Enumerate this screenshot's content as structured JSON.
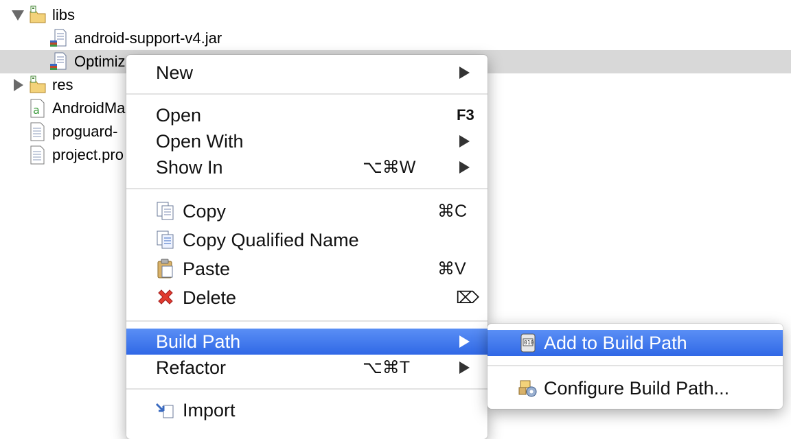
{
  "tree": {
    "items": [
      {
        "label": "libs",
        "icon": "folder-library-icon",
        "expanded": true
      },
      {
        "label": "android-support-v4.jar",
        "icon": "jar-file-icon"
      },
      {
        "label": "Optimiz",
        "icon": "jar-file-icon",
        "selected": true
      },
      {
        "label": "res",
        "icon": "folder-resources-icon",
        "expanded": false
      },
      {
        "label": "AndroidMa",
        "icon": "android-manifest-icon"
      },
      {
        "label": "proguard-",
        "icon": "text-file-icon"
      },
      {
        "label": "project.pro",
        "icon": "text-file-icon"
      }
    ]
  },
  "context_menu": {
    "new": "New",
    "open": "Open",
    "open_shortcut": "F3",
    "open_with": "Open With",
    "show_in": "Show In",
    "show_in_shortcut": "⌥⌘W",
    "copy": "Copy",
    "copy_shortcut": "⌘C",
    "copy_qualified": "Copy Qualified Name",
    "paste": "Paste",
    "paste_shortcut": "⌘V",
    "delete": "Delete",
    "delete_shortcut": "⌦",
    "build_path": "Build Path",
    "refactor": "Refactor",
    "refactor_shortcut": "⌥⌘T",
    "import": "Import"
  },
  "submenu": {
    "add_to_build_path": "Add to Build Path",
    "configure_build_path": "Configure Build Path..."
  },
  "colors": {
    "highlight": "#3a72ea",
    "selection_row": "#d8d8d8",
    "delete_red": "#e03a2e"
  }
}
